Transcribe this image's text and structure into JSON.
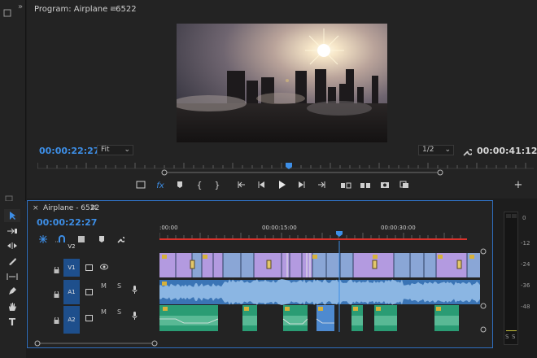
{
  "left_strip": {
    "top_icon": "reel-icon",
    "menu_glyph": "»"
  },
  "monitor": {
    "title": "Program: Airplane - 6522",
    "timecode_current": "00:00:22:27",
    "fit_label": "Fit",
    "quality_label": "1/2",
    "timecode_duration": "00:00:41:12"
  },
  "timeline": {
    "close_glyph": "×",
    "sequence_name": "Airplane - 6522",
    "timecode": "00:00:22:27",
    "ruler": [
      ":00:00",
      "00:00:15:00",
      "00:00:30:00"
    ],
    "tracks": {
      "v2": "V2",
      "v1": "V1",
      "a1": "A1",
      "a2": "A2",
      "mute": "M",
      "solo": "S"
    }
  },
  "meters": {
    "scale": [
      "0",
      "-12",
      "-24",
      "-36",
      "-48"
    ],
    "solo_labels": [
      "S",
      "S"
    ]
  },
  "colors": {
    "accent_blue": "#3d8ee6",
    "playhead_red": "#d9322b",
    "video_clip": "#8aa6d6",
    "video_clip_alt": "#b39ae0",
    "audio_a1": "#3f7dc0",
    "audio_a2": "#2a9c74",
    "fx_badge": "#d6b13a"
  }
}
